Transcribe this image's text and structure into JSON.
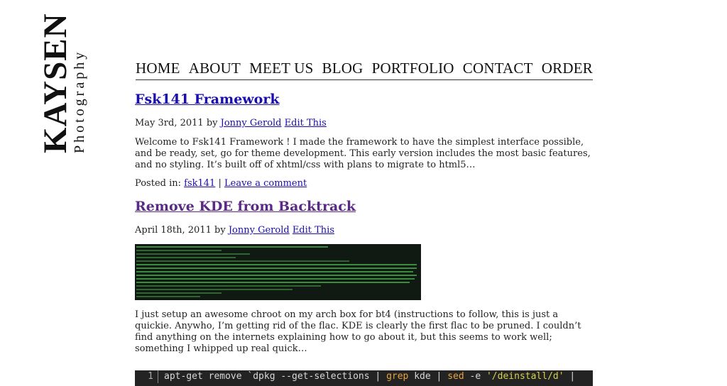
{
  "logo": {
    "main": "KAYSEN",
    "sub": "Photography"
  },
  "nav": {
    "items": [
      "HOME",
      "ABOUT",
      "MEET US",
      "BLOG",
      "PORTFOLIO",
      "CONTACT",
      "ORDER"
    ]
  },
  "posts": [
    {
      "title": "Fsk141 Framework",
      "date": "May 3rd, 2011 by",
      "author": "Jonny Gerold",
      "edit": "Edit This",
      "excerpt": "Welcome to Fsk141 Framework ! I made the framework to have the simplest interface possible, and be ready, set, go for theme development. This early version includes the most basic features, and no styling. It’s built off of xhtml/css with plans to migrate to html5…",
      "posted_in_label": "Posted in:",
      "category": "fsk141",
      "separator": "|",
      "comment": "Leave a comment"
    },
    {
      "title": "Remove KDE from Backtrack",
      "date": "April 18th, 2011 by",
      "author": "Jonny Gerold",
      "edit": "Edit This",
      "excerpt": "I just setup an awesome chroot on my arch box for bt4 (instructions to follow, this is just a quickie. Anywho, I’m getting rid of the flac. KDE is clearly the first flac to be pruned. I couldn’t find anything on the internets explaining how to go about it, but this seems to work well; something I whipped up real quick…"
    }
  ],
  "code": {
    "line_number": "1",
    "part1": "apt-get remove `dpkg --get-selections | ",
    "grep": "grep",
    "part2": " kde | ",
    "sed": "sed",
    "part3": " -e ",
    "str": "'/deinstall/d'",
    "part4": " |"
  },
  "colors": {
    "link": "#1a0dab",
    "visited": "#5b2a86",
    "code_bg": "#232323"
  }
}
